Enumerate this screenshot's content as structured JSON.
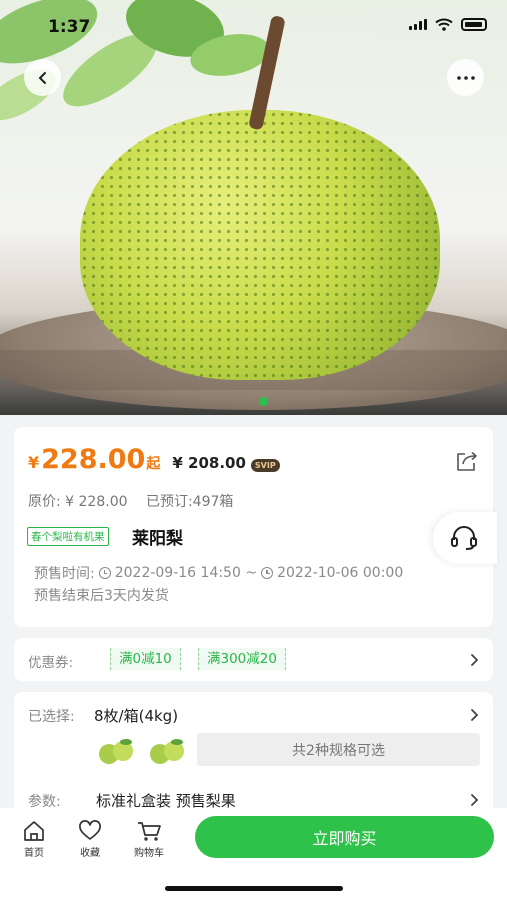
{
  "status_bar": {
    "time": "1:37"
  },
  "product": {
    "currency": "¥",
    "price": "228.00",
    "price_suffix": "起",
    "vip_price": "¥ 208.00",
    "vip_badge": "SVIP",
    "original_price": "原价: ¥ 228.00",
    "booked": "已预订:497箱",
    "tag": "春个梨啦有机果",
    "name": "莱阳梨",
    "presale_label": "预售时间:",
    "presale_start": "2022-09-16 14:50 ~",
    "presale_end": "2022-10-06 00:00",
    "ship_note": "预售结束后3天内发货"
  },
  "coupons": {
    "label": "优惠券:",
    "items": [
      "满0减10",
      "满300减20"
    ]
  },
  "spec": {
    "selected_label": "已选择:",
    "selected_value": "8枚/箱(4kg)",
    "options_button": "共2种规格可选",
    "param_label": "参数:",
    "param_value": "标准礼盒装  预售梨果"
  },
  "bottom_nav": {
    "home": "首页",
    "favorite": "收藏",
    "cart": "购物车",
    "buy": "立即购买"
  },
  "colors": {
    "accent": "#2fc24a",
    "price": "#f07a12"
  }
}
